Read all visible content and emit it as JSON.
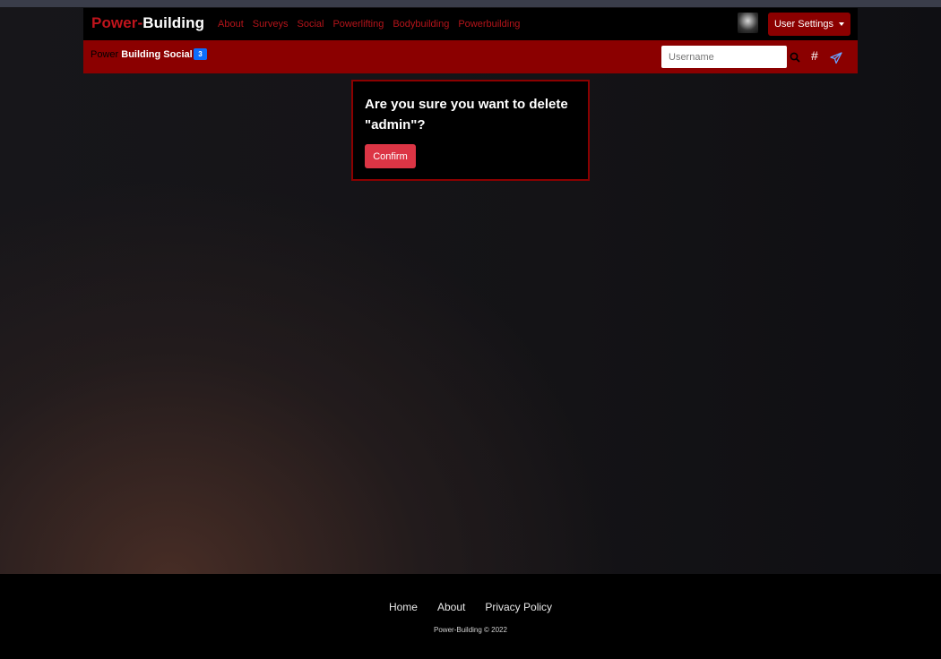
{
  "navbar": {
    "brand_part1": "Power-",
    "brand_part2": "Building",
    "links": [
      "About",
      "Surveys",
      "Social",
      "Powerlifting",
      "Bodybuilding",
      "Powerbuilding"
    ],
    "user_settings_label": "User Settings"
  },
  "subbar": {
    "title_part1": "Power",
    "title_part2": "Building Social",
    "badge_count": "3",
    "search_placeholder": "Username"
  },
  "dialog": {
    "message": "Are you sure you want to delete \"admin\"?",
    "confirm_label": "Confirm"
  },
  "footer": {
    "links": [
      "Home",
      "About",
      "Privacy Policy"
    ],
    "copyright": "Power-Building © 2022"
  },
  "colors": {
    "brand_red": "#c0141c",
    "bar_red": "#8b0000",
    "confirm_red": "#dc3545",
    "badge_blue": "#0d6efd"
  }
}
